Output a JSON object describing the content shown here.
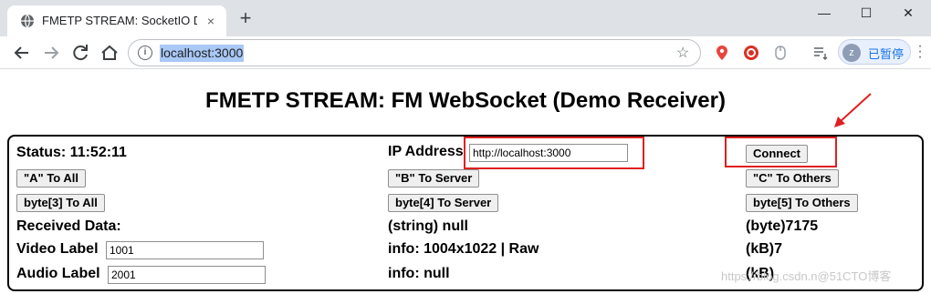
{
  "browser": {
    "tab_title": "FMETP STREAM: SocketIO Demo",
    "tab_close": "×",
    "new_tab": "+",
    "url": "localhost:3000",
    "profile_initial": "z",
    "profile_label": "已暂停",
    "window_controls": {
      "minimize": "—",
      "maximize": "☐",
      "close": "✕"
    }
  },
  "page": {
    "title": "FMETP STREAM: FM WebSocket (Demo Receiver)",
    "status": "Status: 11:52:11",
    "ip_label": "IP Address",
    "ip_value": "http://localhost:3000",
    "connect": "Connect",
    "buttons": {
      "a_to_all": "\"A\" To All",
      "b_to_server": "\"B\" To Server",
      "c_to_others": "\"C\" To Others",
      "byte3_to_all": "byte[3] To All",
      "byte4_to_server": "byte[4] To Server",
      "byte5_to_others": "byte[5] To Others"
    },
    "received_data": "Received Data:",
    "string_value": "(string) null",
    "byte_value": "(byte)7175",
    "video_label": "Video Label",
    "video_value": "1001",
    "video_info": "info: 1004x1022 | Raw",
    "video_kb": "(kB)7",
    "audio_label": "Audio Label",
    "audio_value": "2001",
    "audio_info": "info: null",
    "audio_kb": "(kB)"
  },
  "watermark": "https://blog.csdn.n@51CTO博客",
  "colors": {
    "highlight": "#e02020",
    "url_selection": "#a9c8f5",
    "profile_accent": "#1a73e8"
  },
  "icons": [
    "globe-icon",
    "back-arrow-icon",
    "forward-arrow-icon",
    "reload-icon",
    "info-icon",
    "star-icon",
    "location-pin-icon",
    "adblock-icon",
    "mouse-icon",
    "reading-list-icon",
    "avatar",
    "more-menu-icon",
    "red-arrow-icon"
  ]
}
